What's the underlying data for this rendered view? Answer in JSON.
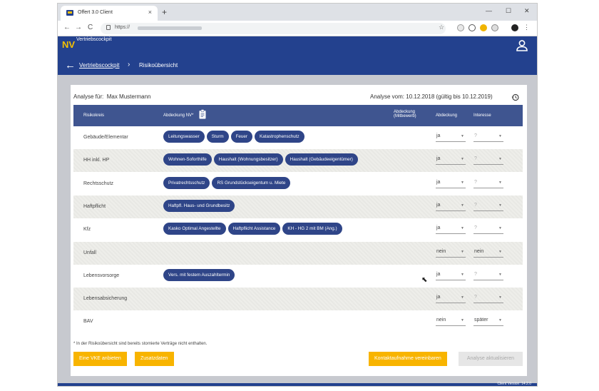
{
  "browser": {
    "tab_title": "Offert 3.0 Client",
    "tab_close": "×",
    "new_tab": "+",
    "url": "https://",
    "win_min": "—",
    "win_max": "☐",
    "win_close": "✕",
    "back": "←",
    "forward": "→",
    "reload": "C",
    "star": "☆",
    "menu": "⋮"
  },
  "app": {
    "logo": "NV",
    "brand": "Vertriebscockpit",
    "breadcrumb": {
      "back_icon": "←",
      "link": "Vertriebscockpit",
      "separator": "›",
      "current": "Risikoübersicht"
    },
    "version": "Client Version: 14.2.0"
  },
  "panel": {
    "analyse_for_label": "Analyse für:",
    "analyse_for_name": "Max Mustermann",
    "analyse_date": "Analyse vom: 10.12.2018 (gültig bis 10.12.2019)",
    "columns": {
      "risk": "Risikokreis",
      "coverage_nv": "Abdeckung NV*",
      "coverage_comp_1": "Abdeckung",
      "coverage_comp_2": "(Mitbewerb)",
      "coverage": "Abdeckung",
      "interest": "Interesse"
    },
    "rows": [
      {
        "label": "Gebäude/Elementar",
        "chips": [
          "Leitungswasser",
          "Sturm",
          "Feuer",
          "Katastrophenschutz"
        ],
        "abdeckung": "ja",
        "interesse": "?"
      },
      {
        "label": "HH inkl. HP",
        "chips": [
          "Wohnen-Soforthilfe",
          "Haushalt (Wohnungsbesitzer)",
          "Haushalt (Gebäudeeigentümer)"
        ],
        "abdeckung": "ja",
        "interesse": "?"
      },
      {
        "label": "Rechtsschutz",
        "chips": [
          "Privatrechtsschutz",
          "RS Grundstückseigentum u. Miete"
        ],
        "abdeckung": "ja",
        "interesse": "?"
      },
      {
        "label": "Haftpflicht",
        "chips": [
          "Haftpfl. Haus- und Grundbesitz"
        ],
        "abdeckung": "ja",
        "interesse": "?"
      },
      {
        "label": "Kfz",
        "chips": [
          "Kasko Optimal Angestellte",
          "Haftpflicht Assistance",
          "KH - HG 2 mit BM (Ang.)"
        ],
        "abdeckung": "ja",
        "interesse": "?"
      },
      {
        "label": "Unfall",
        "chips": [],
        "abdeckung": "nein",
        "interesse": "nein"
      },
      {
        "label": "Lebensvorsorge",
        "chips": [
          "Vers. mit festem Auszahltermin"
        ],
        "abdeckung": "ja",
        "interesse": "?"
      },
      {
        "label": "Lebensabsicherung",
        "chips": [],
        "abdeckung": "ja",
        "interesse": "?"
      },
      {
        "label": "BAV",
        "chips": [],
        "abdeckung": "nein",
        "interesse": "später"
      }
    ],
    "caret": "▼",
    "footnote": "* In der Risikoübersicht sind bereits stornierte Verträge nicht enthalten.",
    "buttons": {
      "vke": "Eine VKE anbieten",
      "extra": "Zusatzdaten",
      "contact": "Kontaktaufnahme vereinbaren",
      "refresh": "Analyse aktualisieren"
    }
  },
  "colors": {
    "brand_blue": "#23418e",
    "chip_blue": "#2f4588",
    "header_blue": "#3f5590",
    "accent_yellow": "#f8b400",
    "logo_yellow": "#f4c000"
  }
}
